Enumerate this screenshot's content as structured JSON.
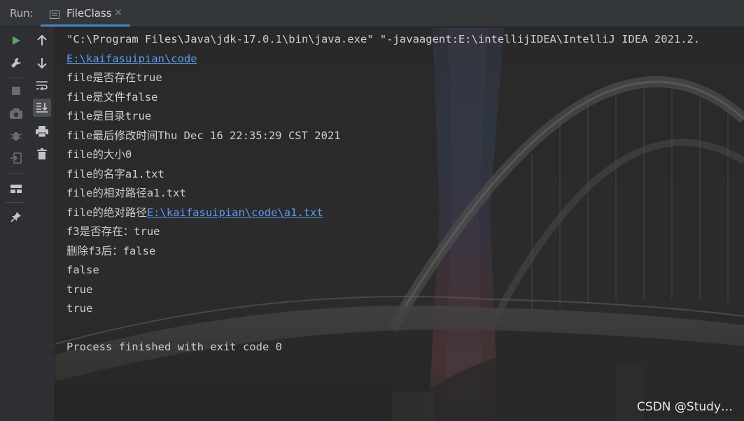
{
  "run_panel": {
    "label": "Run:",
    "tab": {
      "title": "FileClass",
      "icon": "console-tab-icon",
      "close": "×"
    }
  },
  "toolbar_left": [
    {
      "name": "rerun-icon",
      "color": "#59a869"
    },
    {
      "name": "wrench-icon",
      "color": "#c4c4c4"
    },
    {
      "name": "stop-icon",
      "color": "#6b6b6b"
    },
    {
      "name": "camera-icon",
      "color": "#6b6b6b"
    },
    {
      "name": "bug-icon",
      "color": "#6b6b6b"
    },
    {
      "name": "exit-icon",
      "color": "#6b6b6b"
    },
    {
      "name": "layout-icon",
      "color": "#c4c4c4"
    },
    {
      "name": "pin-icon",
      "color": "#c4c4c4"
    }
  ],
  "toolbar_right": [
    {
      "name": "arrow-up-icon"
    },
    {
      "name": "arrow-down-icon"
    },
    {
      "name": "soft-wrap-icon"
    },
    {
      "name": "scroll-to-end-icon"
    },
    {
      "name": "print-icon"
    },
    {
      "name": "trash-icon"
    }
  ],
  "console": {
    "lines": [
      {
        "text": "\"C:\\Program Files\\Java\\jdk-17.0.1\\bin\\java.exe\" \"-javaagent:E:\\intellijIDEA\\IntelliJ IDEA 2021.2.",
        "link": ""
      },
      {
        "text": "",
        "link": "E:\\kaifasuipian\\code"
      },
      {
        "text": "file是否存在true",
        "link": ""
      },
      {
        "text": "file是文件false",
        "link": ""
      },
      {
        "text": "file是目录true",
        "link": ""
      },
      {
        "text": "file最后修改时间Thu Dec 16 22:35:29 CST 2021",
        "link": ""
      },
      {
        "text": "file的大小0",
        "link": ""
      },
      {
        "text": "file的名字a1.txt",
        "link": ""
      },
      {
        "text": "file的相对路径a1.txt",
        "link": ""
      },
      {
        "text": "file的绝对路径",
        "link": "E:\\kaifasuipian\\code\\a1.txt"
      },
      {
        "text": "f3是否存在：true",
        "link": ""
      },
      {
        "text": "删除f3后：false",
        "link": ""
      },
      {
        "text": "false",
        "link": ""
      },
      {
        "text": "true",
        "link": ""
      },
      {
        "text": "true",
        "link": ""
      },
      {
        "text": "",
        "link": ""
      },
      {
        "text": "Process finished with exit code 0",
        "link": ""
      }
    ]
  },
  "watermark": "CSDN @Study…",
  "colors": {
    "accent": "#4a88c7",
    "link": "#5a9cf0",
    "text": "#cfcfcf",
    "run_green": "#59a869"
  }
}
